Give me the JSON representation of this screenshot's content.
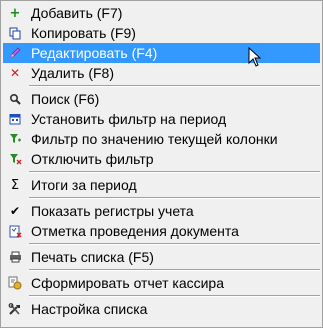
{
  "context_menu": {
    "items": [
      {
        "label": "Добавить (F7)",
        "icon": "plus-icon"
      },
      {
        "label": "Копировать (F9)",
        "icon": "copy-icon"
      },
      {
        "label": "Редактировать (F4)",
        "icon": "pencil-icon",
        "highlighted": true
      },
      {
        "label": "Удалить (F8)",
        "icon": "delete-x-icon"
      },
      {
        "label": "Поиск (F6)",
        "icon": "search-icon"
      },
      {
        "label": "Установить фильтр на период",
        "icon": "calendar-icon"
      },
      {
        "label": "Фильтр по значению текущей колонки",
        "icon": "filter-value-icon"
      },
      {
        "label": "Отключить фильтр",
        "icon": "filter-off-icon"
      },
      {
        "label": "Итоги за период",
        "icon": "sigma-icon"
      },
      {
        "label": "Показать регистры учета",
        "icon": "checkmark-icon"
      },
      {
        "label": "Отметка проведения документа",
        "icon": "document-mark-icon"
      },
      {
        "label": "Печать списка (F5)",
        "icon": "printer-icon"
      },
      {
        "label": "Сформировать отчет кассира",
        "icon": "cashier-report-icon"
      },
      {
        "label": "Настройка списка",
        "icon": "tools-icon"
      }
    ]
  },
  "colors": {
    "highlight": "#3399ff",
    "menu_background": "#f0f0f0",
    "separator": "#a0a0a0"
  }
}
